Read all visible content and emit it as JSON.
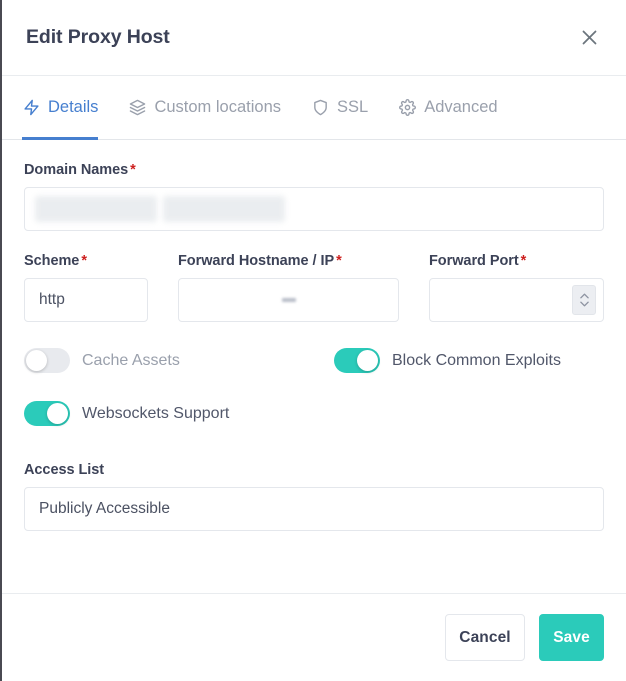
{
  "header": {
    "title": "Edit Proxy Host",
    "close_icon": "close-icon"
  },
  "tabs": [
    {
      "label": "Details",
      "icon": "lightning-bolt-icon",
      "active": true
    },
    {
      "label": "Custom locations",
      "icon": "layers-icon",
      "active": false
    },
    {
      "label": "SSL",
      "icon": "shield-icon",
      "active": false
    },
    {
      "label": "Advanced",
      "icon": "gear-icon",
      "active": false
    }
  ],
  "form": {
    "domain_names": {
      "label": "Domain Names",
      "required_marker": "*",
      "tags": [
        "",
        ""
      ]
    },
    "scheme": {
      "label": "Scheme",
      "required_marker": "*",
      "value": "http"
    },
    "forward_hostname": {
      "label": "Forward Hostname / IP",
      "required_marker": "*",
      "value": ""
    },
    "forward_port": {
      "label": "Forward Port",
      "required_marker": "*",
      "value": "",
      "spinner_icon": "stepper-chevrons-icon"
    },
    "toggles": [
      {
        "label": "Cache Assets",
        "on": false
      },
      {
        "label": "Block Common Exploits",
        "on": true
      },
      {
        "label": "Websockets Support",
        "on": true
      }
    ],
    "access_list": {
      "label": "Access List",
      "value": "Publicly Accessible"
    }
  },
  "footer": {
    "cancel_label": "Cancel",
    "save_label": "Save"
  },
  "colors": {
    "accent_teal": "#2bcbba",
    "tab_active_blue": "#467fcf",
    "required_red": "#cd201f",
    "text_dark": "#3c4257",
    "text_muted": "#9aa0ac"
  }
}
